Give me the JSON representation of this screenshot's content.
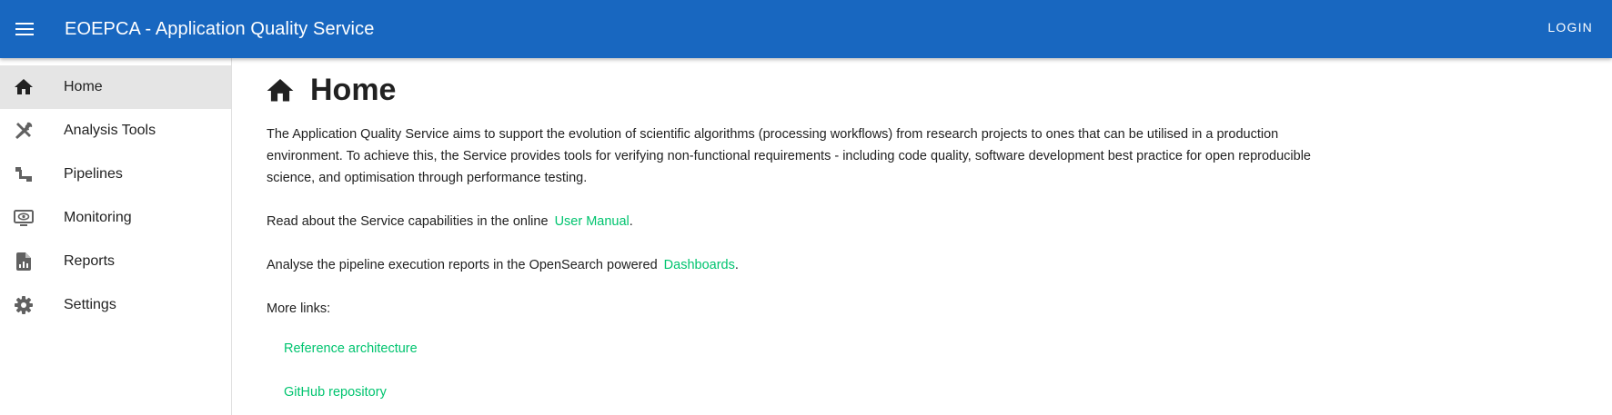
{
  "appbar": {
    "title": "EOEPCA - Application Quality Service",
    "login_label": "LOGIN",
    "menu_icon": "hamburger-menu-icon"
  },
  "colors": {
    "appbar": "#1867c0",
    "link": "#00c46f",
    "active_nav_bg": "#e5e5e5"
  },
  "sidebar": {
    "items": [
      {
        "label": "Home",
        "icon": "home-icon",
        "active": true
      },
      {
        "label": "Analysis Tools",
        "icon": "tools-icon",
        "active": false
      },
      {
        "label": "Pipelines",
        "icon": "pipeline-icon",
        "active": false
      },
      {
        "label": "Monitoring",
        "icon": "monitor-eye-icon",
        "active": false
      },
      {
        "label": "Reports",
        "icon": "report-file-icon",
        "active": false
      },
      {
        "label": "Settings",
        "icon": "gear-icon",
        "active": false
      }
    ]
  },
  "main": {
    "title": "Home",
    "title_icon": "home-icon",
    "intro": "The Application Quality Service aims to support the evolution of scientific algorithms (processing workflows) from research projects to ones that can be utilised in a production environment. To achieve this, the Service provides tools for verifying non-functional requirements - including code quality, software development best practice for open reproducible science, and optimisation through performance testing.",
    "manual_text": "Read about the Service capabilities in the online",
    "manual_link": "User Manual",
    "dashboards_text": "Analyse the pipeline execution reports in the OpenSearch powered",
    "dashboards_link": "Dashboards",
    "period": ".",
    "more_links_label": "More links:",
    "more_links": [
      "Reference architecture",
      "GitHub repository"
    ]
  }
}
